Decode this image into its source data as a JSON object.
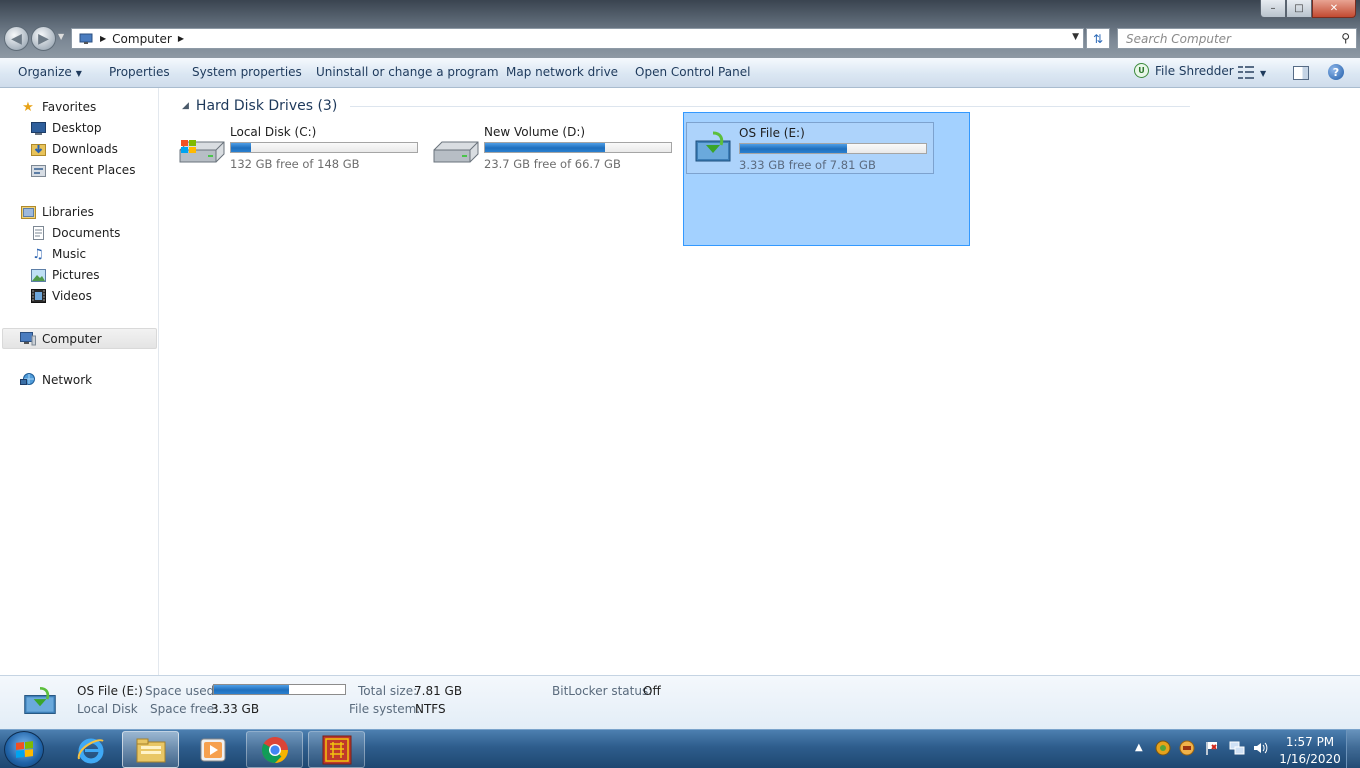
{
  "window": {
    "minimize_glyph": "–",
    "maximize_glyph": "□",
    "close_glyph": "✕"
  },
  "address": {
    "location": "Computer",
    "search_placeholder": "Search Computer"
  },
  "toolbar": {
    "organize": "Organize",
    "properties": "Properties",
    "system_properties": "System properties",
    "uninstall": "Uninstall or change a program",
    "map_drive": "Map network drive",
    "control_panel": "Open Control Panel",
    "file_shredder": "File Shredder"
  },
  "sidebar": {
    "favorites": "Favorites",
    "desktop": "Desktop",
    "downloads": "Downloads",
    "recent_places": "Recent Places",
    "libraries": "Libraries",
    "documents": "Documents",
    "music": "Music",
    "pictures": "Pictures",
    "videos": "Videos",
    "computer": "Computer",
    "network": "Network"
  },
  "content": {
    "group_title": "Hard Disk Drives (3)",
    "drives": [
      {
        "name": "Local Disk (C:)",
        "free_text": "132 GB free of 148 GB",
        "used_fraction": 0.108
      },
      {
        "name": "New Volume (D:)",
        "free_text": "23.7 GB free of 66.7 GB",
        "used_fraction": 0.645
      },
      {
        "name": "OS File (E:)",
        "free_text": "3.33 GB free of 7.81 GB",
        "used_fraction": 0.574
      }
    ]
  },
  "details": {
    "name": "OS File (E:)",
    "type": "Local Disk",
    "space_used_label": "Space used:",
    "space_used_fraction": 0.574,
    "space_free_label": "Space free:",
    "space_free": "3.33 GB",
    "total_size_label": "Total size:",
    "total_size": "7.81 GB",
    "file_system_label": "File system:",
    "file_system": "NTFS",
    "bitlocker_label": "BitLocker status:",
    "bitlocker": "Off"
  },
  "taskbar": {
    "time": "1:57 PM",
    "date": "1/16/2020"
  },
  "colors": {
    "accent": "#1f6fbd",
    "selection": "#3399ff",
    "taskbar": "#2e5d8c"
  }
}
